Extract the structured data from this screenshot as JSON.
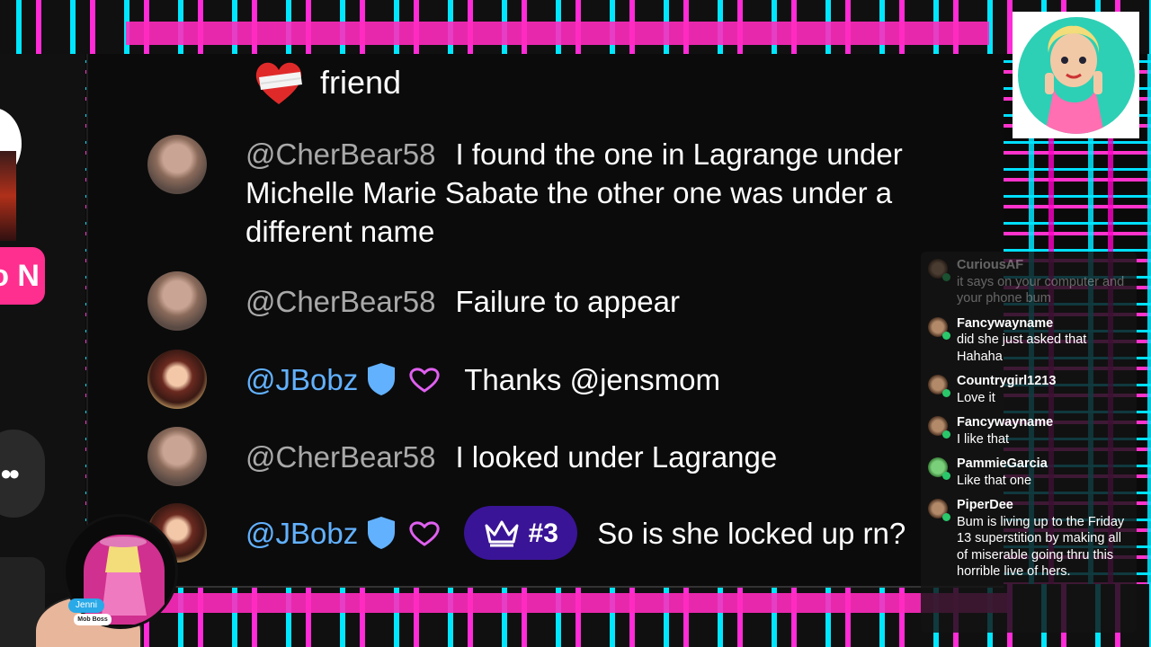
{
  "left_panel": {
    "pill_text": "o N"
  },
  "top_message": {
    "text": "friend",
    "icon": "bandaged-heart-icon"
  },
  "messages": [
    {
      "user": "@CherBear58",
      "text": "I found the one in Lagrange under Michelle Marie Sabate the other one was under a different name",
      "verified": false
    },
    {
      "user": "@CherBear58",
      "text": "Failure to appear",
      "verified": false
    },
    {
      "user": "@JBobz",
      "text": "Thanks @jensmom",
      "verified": true
    },
    {
      "user": "@CherBear58",
      "text": "I looked under Lagrange",
      "verified": false
    },
    {
      "user": "@JBobz",
      "text": "So is she locked up rn?",
      "verified": true,
      "rank": "#3"
    }
  ],
  "side_chat": [
    {
      "name": "CuriousAF",
      "text": "it says on your computer and your phone bum"
    },
    {
      "name": "Fancywayname",
      "text": "did she just asked that Hahaha"
    },
    {
      "name": "Countrygirl1213",
      "text": "Love it"
    },
    {
      "name": "Fancywayname",
      "text": "I like that"
    },
    {
      "name": "PammieGarcia",
      "text": "Like that one"
    },
    {
      "name": "PiperDee",
      "text": "Bum is living up to the Friday 13 superstition by making all of miserable going thru this horrible live of hers."
    }
  ],
  "host": {
    "name": "Jenni",
    "role": "Mob Boss"
  },
  "colors": {
    "username_grey": "#a9a9a9",
    "username_blue": "#62b1ff",
    "rank_badge": "#3a1496",
    "accent_pink": "#ff2bbf",
    "accent_cyan": "#00e6ff"
  }
}
